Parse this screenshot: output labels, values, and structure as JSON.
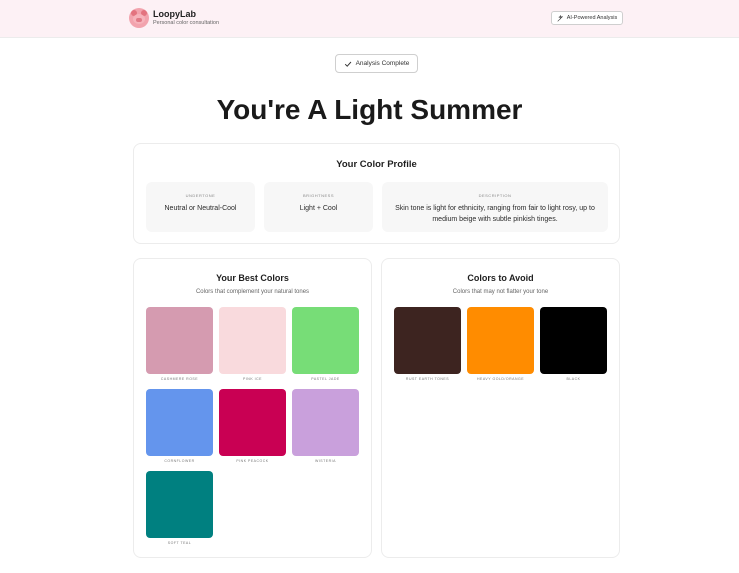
{
  "header": {
    "brand_name": "LoopyLab",
    "tagline": "Personal color consultation",
    "ai_button_label": "AI-Powered Analysis"
  },
  "status": {
    "label": "Analysis Complete"
  },
  "result_title": "You're A Light Summer",
  "profile": {
    "title": "Your Color Profile",
    "undertone": {
      "label": "UNDERTONE",
      "value": "Neutral or Neutral-Cool"
    },
    "brightness": {
      "label": "BRIGHTNESS",
      "value": "Light + Cool"
    },
    "description": {
      "label": "DESCRIPTION",
      "value": "Skin tone is light for ethnicity, ranging from fair to light rosy, up to medium beige with subtle pinkish tinges."
    }
  },
  "best_colors": {
    "title": "Your Best Colors",
    "subtitle": "Colors that complement your natural tones",
    "items": [
      {
        "label": "CASHMERE ROSE",
        "color": "#d59bb0"
      },
      {
        "label": "PINK ICE",
        "color": "#f9dadd"
      },
      {
        "label": "PASTEL JADE",
        "color": "#77dd77"
      },
      {
        "label": "CORNFLOWER",
        "color": "#6495ed"
      },
      {
        "label": "PINK PEACOCK",
        "color": "#c90053"
      },
      {
        "label": "WISTERIA",
        "color": "#c9a0dc"
      },
      {
        "label": "SOFT TEAL",
        "color": "#008080"
      }
    ]
  },
  "avoid_colors": {
    "title": "Colors to Avoid",
    "subtitle": "Colors that may not flatter your tone",
    "items": [
      {
        "label": "RUST EARTH TONES",
        "color": "#3d2420"
      },
      {
        "label": "HEAVY GOLD/ORANGE",
        "color": "#ff8c00"
      },
      {
        "label": "BLACK",
        "color": "#000000"
      }
    ]
  }
}
